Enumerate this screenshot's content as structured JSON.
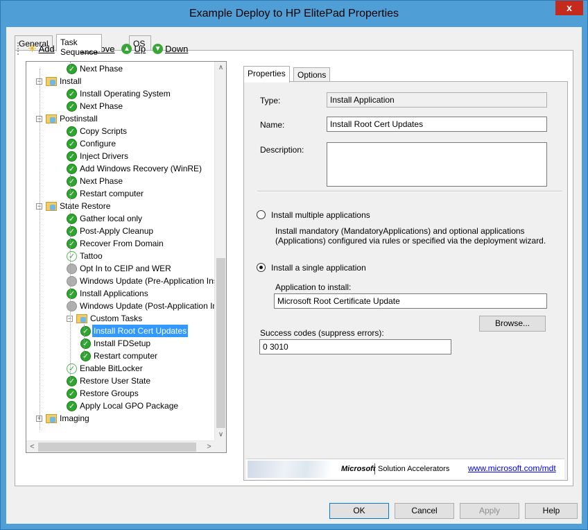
{
  "window": {
    "title": "Example Deploy to HP ElitePad Properties",
    "close_glyph": "x"
  },
  "outer_tabs": [
    "General",
    "Task Sequence",
    "OS Info"
  ],
  "toolbar": {
    "add": "Add",
    "remove": "Remove",
    "up": "Up",
    "down": "Down"
  },
  "tree": [
    {
      "label": "Next Phase",
      "kind": "check",
      "level": 2
    },
    {
      "label": "Install",
      "kind": "folder",
      "level": 1
    },
    {
      "label": "Install Operating System",
      "kind": "check",
      "level": 2
    },
    {
      "label": "Next Phase",
      "kind": "check",
      "level": 2
    },
    {
      "label": "Postinstall",
      "kind": "folder",
      "level": 1
    },
    {
      "label": "Copy Scripts",
      "kind": "check",
      "level": 2
    },
    {
      "label": "Configure",
      "kind": "check",
      "level": 2
    },
    {
      "label": "Inject Drivers",
      "kind": "check",
      "level": 2
    },
    {
      "label": "Add Windows Recovery (WinRE)",
      "kind": "check",
      "level": 2
    },
    {
      "label": "Next Phase",
      "kind": "check",
      "level": 2
    },
    {
      "label": "Restart computer",
      "kind": "check",
      "level": 2
    },
    {
      "label": "State Restore",
      "kind": "folder",
      "level": 1
    },
    {
      "label": "Gather local only",
      "kind": "check",
      "level": 2
    },
    {
      "label": "Post-Apply Cleanup",
      "kind": "check",
      "level": 2
    },
    {
      "label": "Recover From Domain",
      "kind": "check",
      "level": 2
    },
    {
      "label": "Tattoo",
      "kind": "light",
      "level": 2
    },
    {
      "label": "Opt In to CEIP and WER",
      "kind": "grey",
      "level": 2
    },
    {
      "label": "Windows Update (Pre-Application Inst",
      "kind": "grey",
      "level": 2
    },
    {
      "label": "Install Applications",
      "kind": "check",
      "level": 2
    },
    {
      "label": "Windows Update (Post-Application Ins",
      "kind": "grey",
      "level": 2
    },
    {
      "label": "Custom Tasks",
      "kind": "folder",
      "level": 2
    },
    {
      "label": "Install Root Cert Updates",
      "kind": "check",
      "level": 3,
      "selected": true
    },
    {
      "label": "Install FDSetup",
      "kind": "check",
      "level": 3
    },
    {
      "label": "Restart computer",
      "kind": "check",
      "level": 3
    },
    {
      "label": "Enable BitLocker",
      "kind": "light",
      "level": 2
    },
    {
      "label": "Restore User State",
      "kind": "check",
      "level": 2
    },
    {
      "label": "Restore Groups",
      "kind": "check",
      "level": 2
    },
    {
      "label": "Apply Local GPO Package",
      "kind": "check",
      "level": 2
    },
    {
      "label": "Imaging",
      "kind": "folder-collapsed",
      "level": 1
    }
  ],
  "inner_tabs": [
    "Properties",
    "Options"
  ],
  "props": {
    "type_label": "Type:",
    "type_value": "Install Application",
    "name_label": "Name:",
    "name_value": "Install Root Cert Updates",
    "description_label": "Description:",
    "description_value": "",
    "radio_multiple": "Install multiple applications",
    "multiple_desc": "Install mandatory (MandatoryApplications) and optional applications (Applications) configured via rules or specified via the deployment wizard.",
    "radio_single": "Install a single application",
    "app_label": "Application to install:",
    "app_value": "Microsoft Root Certificate Update",
    "browse": "Browse...",
    "success_label": "Success codes (suppress errors):",
    "success_value": "0 3010"
  },
  "footer": {
    "microsoft": "Microsoft",
    "solution": "Solution Accelerators",
    "link": "www.microsoft.com/mdt"
  },
  "buttons": {
    "ok": "OK",
    "cancel": "Cancel",
    "apply": "Apply",
    "help": "Help"
  }
}
